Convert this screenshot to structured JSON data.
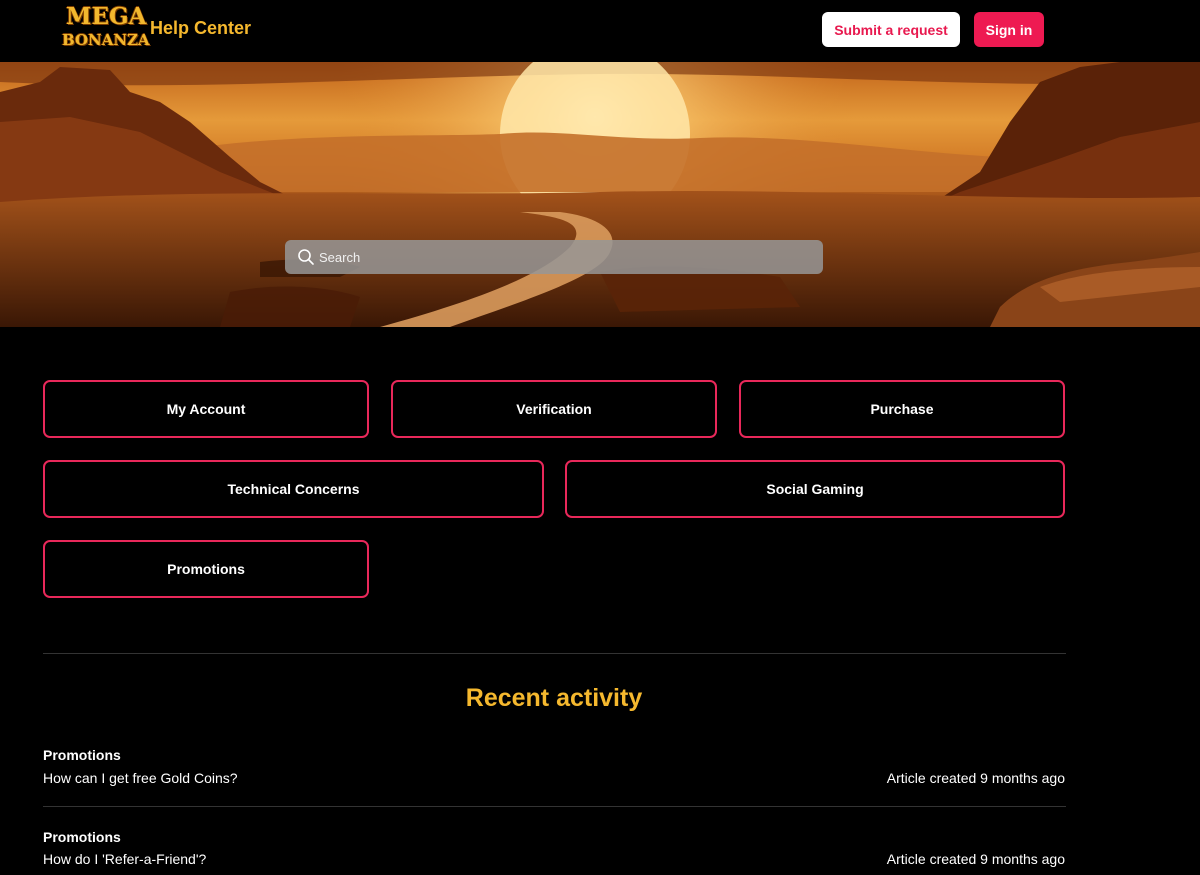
{
  "header": {
    "logo_top": "MEGA",
    "logo_bottom": "BONANZA",
    "title": "Help Center",
    "submit_label": "Submit a request",
    "signin_label": "Sign in"
  },
  "search": {
    "placeholder": "Search"
  },
  "categories": [
    {
      "label": "My Account"
    },
    {
      "label": "Verification"
    },
    {
      "label": "Purchase"
    },
    {
      "label": "Technical Concerns"
    },
    {
      "label": "Social Gaming"
    },
    {
      "label": "Promotions"
    }
  ],
  "recent": {
    "title": "Recent activity",
    "items": [
      {
        "category": "Promotions",
        "title": "How can I get free Gold Coins?",
        "meta": "Article created 9 months ago"
      },
      {
        "category": "Promotions",
        "title": "How do I 'Refer-a-Friend'?",
        "meta": "Article created 9 months ago"
      }
    ]
  },
  "colors": {
    "accent_pink": "#ee1a52",
    "accent_gold": "#f5b82e",
    "background": "#000000"
  }
}
